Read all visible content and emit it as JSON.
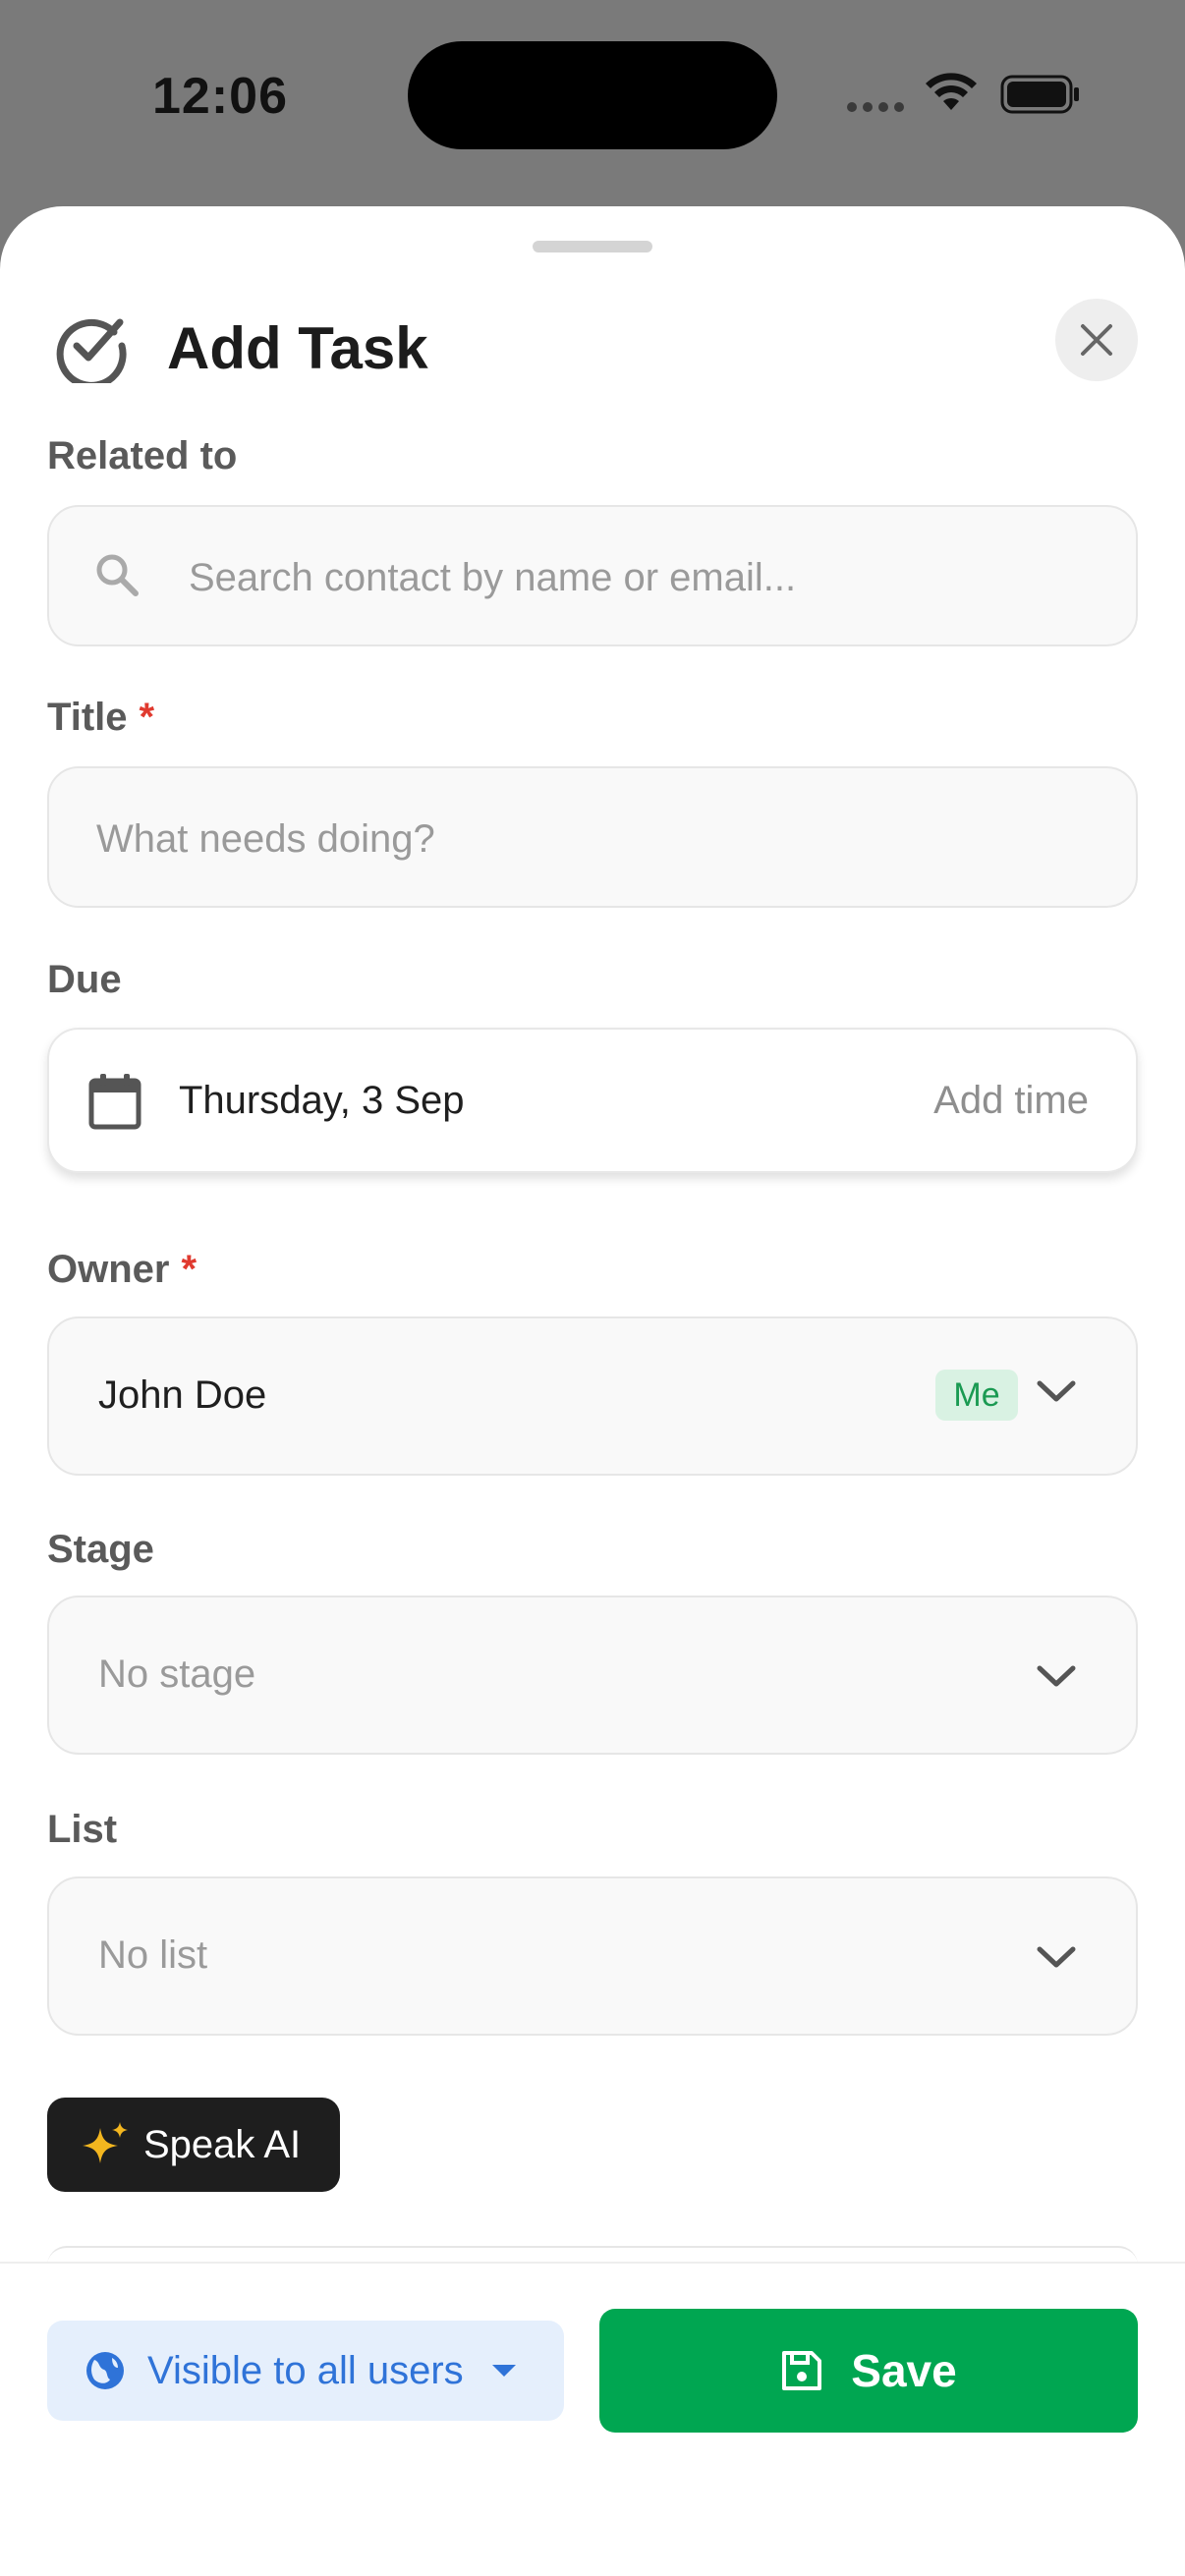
{
  "status_bar": {
    "time": "12:06"
  },
  "sheet": {
    "title": "Add Task",
    "related": {
      "label": "Related to",
      "placeholder": "Search contact by name or email..."
    },
    "task_title": {
      "label": "Title",
      "required_mark": "*",
      "placeholder": "What needs doing?"
    },
    "due": {
      "label": "Due",
      "date": "Thursday, 3 Sep",
      "add_time": "Add time"
    },
    "owner": {
      "label": "Owner",
      "required_mark": "*",
      "value": "John Doe",
      "badge": "Me"
    },
    "stage": {
      "label": "Stage",
      "value": "No stage"
    },
    "list": {
      "label": "List",
      "value": "No list"
    },
    "speak_ai": {
      "label": "Speak AI"
    }
  },
  "footer": {
    "visibility_label": "Visible to all users",
    "save_label": "Save"
  },
  "colors": {
    "primary_green": "#00a651",
    "link_blue": "#2f73d8",
    "required_red": "#e03a2f",
    "badge_green_bg": "#d9f2e3"
  },
  "icons": [
    "task-check-icon",
    "close-icon",
    "search-icon",
    "calendar-icon",
    "chevron-down-icon",
    "sparkle-icon",
    "globe-icon",
    "caret-down-icon",
    "save-icon",
    "wifi-icon",
    "battery-icon"
  ]
}
